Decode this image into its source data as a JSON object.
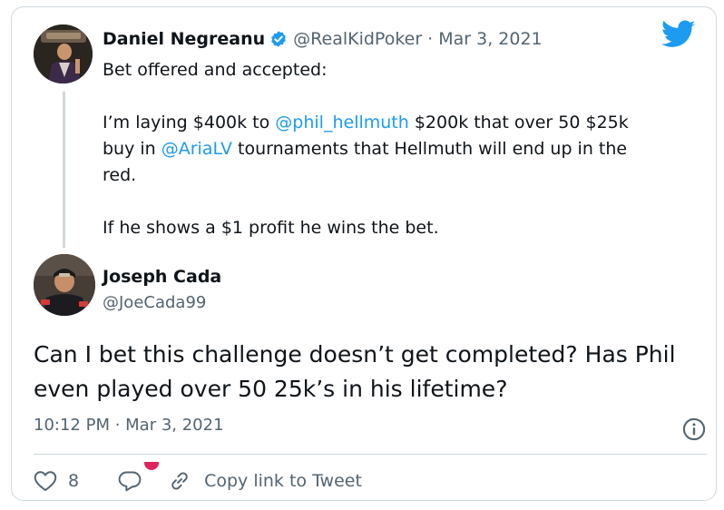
{
  "quoted_tweet": {
    "author_name": "Daniel Negreanu",
    "handle": "@RealKidPoker",
    "separator": "·",
    "date": "Mar 3, 2021",
    "intro": "Bet offered and accepted:",
    "para1_a": "I’m laying $400k to ",
    "mention1": "@phil_hellmuth",
    "para1_b": " $200k that over 50 $25k buy in ",
    "mention2": "@AriaLV",
    "para1_c": " tournaments that Hellmuth will end up in the red.",
    "para2": "If he shows a $1 profit he wins the bet."
  },
  "main_tweet": {
    "author_name": "Joseph Cada",
    "handle": "@JoeCada99",
    "text": "Can I bet this challenge doesn’t get completed? Has Phil even played over 50 25k’s in his lifetime?",
    "timestamp": "10:12 PM · Mar 3, 2021"
  },
  "actions": {
    "like_count": "8",
    "copy_link_label": "Copy link to Tweet"
  },
  "icons": {
    "brand": "twitter-bird-icon",
    "verified": "verified-badge-icon",
    "info": "info-icon",
    "like": "heart-icon",
    "reply": "reply-bubble-icon",
    "copy": "link-icon"
  },
  "colors": {
    "brand_blue": "#1d9bf0",
    "text_primary": "#0f1419",
    "text_secondary": "#536471",
    "border": "#cfd9de",
    "notification": "#e0245e"
  }
}
